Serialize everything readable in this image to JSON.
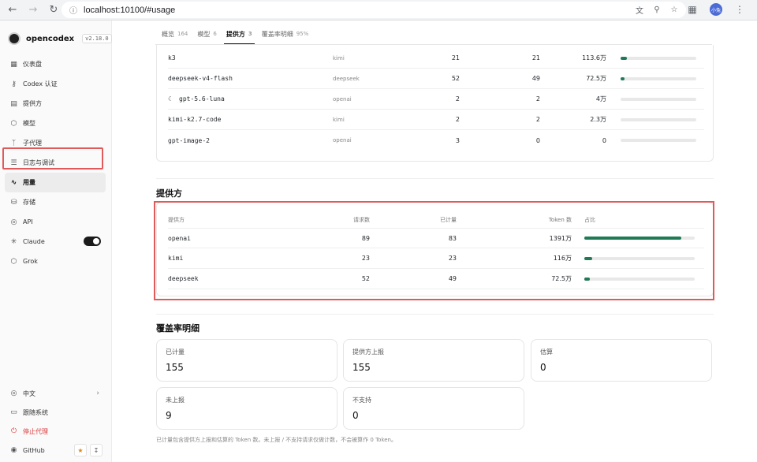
{
  "browser": {
    "url": "localhost:10100/#usage",
    "profile_label": "小兔"
  },
  "sidebar": {
    "app_name": "opencodex",
    "version": "v2.18.0",
    "items": [
      {
        "label": "仪表盘",
        "icon": "grid-icon"
      },
      {
        "label": "Codex 认证",
        "icon": "key-icon"
      },
      {
        "label": "提供方",
        "icon": "server-icon"
      },
      {
        "label": "模型",
        "icon": "cube-icon"
      },
      {
        "label": "子代理",
        "icon": "branch-icon"
      },
      {
        "label": "日志与调试",
        "icon": "list-icon"
      },
      {
        "label": "用量",
        "icon": "activity-icon",
        "active": true
      },
      {
        "label": "存储",
        "icon": "database-icon"
      },
      {
        "label": "API",
        "icon": "globe-icon"
      },
      {
        "label": "Claude",
        "icon": "asterisk-icon",
        "toggle": true
      },
      {
        "label": "Grok",
        "icon": "cube-icon"
      }
    ],
    "bottom": {
      "language": "中文",
      "follow_system": "跟随系统",
      "stop_proxy": "停止代理",
      "github": "GitHub"
    }
  },
  "tabs": [
    {
      "label": "概览",
      "count": "164"
    },
    {
      "label": "模型",
      "count": "6"
    },
    {
      "label": "提供方",
      "count": "3",
      "active": true
    },
    {
      "label": "覆盖率明细",
      "count": "95%"
    }
  ],
  "models": {
    "rows": [
      {
        "name": "k3",
        "provider": "kimi",
        "requests": "21",
        "metered": "21",
        "tokens": "113.6万",
        "share": 0.08
      },
      {
        "name": "deepseek-v4-flash",
        "provider": "deepseek",
        "requests": "52",
        "metered": "49",
        "tokens": "72.5万",
        "share": 0.05
      },
      {
        "name": "gpt-5.6-luna",
        "provider": "openai",
        "requests": "2",
        "metered": "2",
        "tokens": "4万",
        "share": 0.0,
        "moon": true
      },
      {
        "name": "kimi-k2.7-code",
        "provider": "kimi",
        "requests": "2",
        "metered": "2",
        "tokens": "2.3万",
        "share": 0.0
      },
      {
        "name": "gpt-image-2",
        "provider": "openai",
        "requests": "3",
        "metered": "0",
        "tokens": "0",
        "share": 0.0
      }
    ]
  },
  "providers": {
    "title": "提供方",
    "headers": {
      "provider": "提供方",
      "requests": "请求数",
      "metered": "已计量",
      "tokens": "Token 数",
      "share": "占比"
    },
    "rows": [
      {
        "name": "openai",
        "requests": "89",
        "metered": "83",
        "tokens": "1391万",
        "share": 0.88
      },
      {
        "name": "kimi",
        "requests": "23",
        "metered": "23",
        "tokens": "116万",
        "share": 0.07
      },
      {
        "name": "deepseek",
        "requests": "52",
        "metered": "49",
        "tokens": "72.5万",
        "share": 0.05
      }
    ]
  },
  "coverage": {
    "title": "覆盖率明细",
    "stats": [
      {
        "label": "已计量",
        "value": "155"
      },
      {
        "label": "提供方上报",
        "value": "155"
      },
      {
        "label": "估算",
        "value": "0"
      },
      {
        "label": "未上报",
        "value": "9"
      },
      {
        "label": "不支持",
        "value": "0"
      }
    ],
    "footnote": "已计量包含提供方上报和估算的 Token 数。未上报 / 不支持请求仅做计数，不会被算作 0 Token。"
  },
  "colors": {
    "accent": "#1f7a55",
    "highlight": "#e05a5a"
  }
}
